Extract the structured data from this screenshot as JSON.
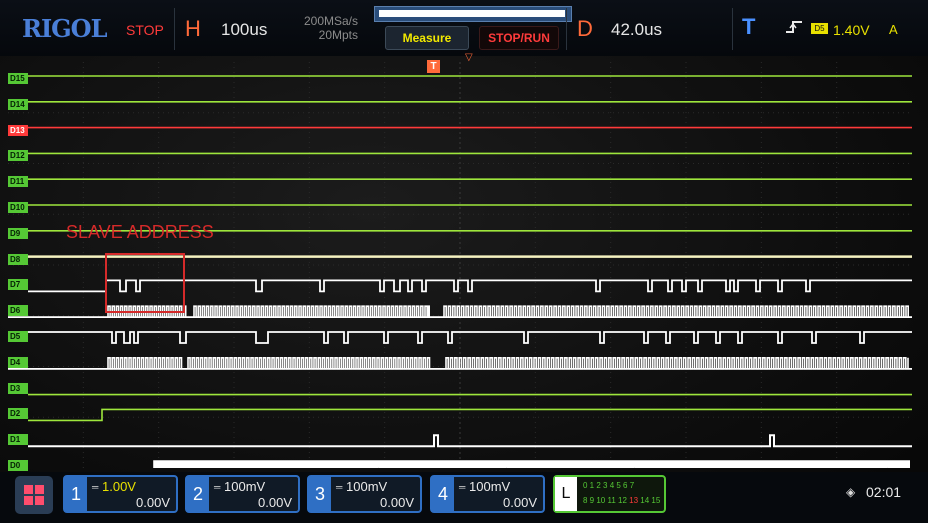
{
  "topbar": {
    "logo": "RIGOL",
    "status": "STOP",
    "h_label": "H",
    "h_value": "100us",
    "sample_rate": "200MSa/s",
    "mem_depth": "20Mpts",
    "measure_label": "Measure",
    "stoprun_label": "STOP/RUN",
    "d_label": "D",
    "d_value": "42.0us",
    "t_label": "T",
    "trigger_icon": "rising-edge-icon",
    "trigger_source": "D5",
    "trigger_level": "1.40V",
    "trigger_mode": "A"
  },
  "plot": {
    "trigger_marker": "T",
    "channels": [
      "D15",
      "D14",
      "D13",
      "D12",
      "D11",
      "D10",
      "D9",
      "D8",
      "D7",
      "D6",
      "D5",
      "D4",
      "D3",
      "D2",
      "D1",
      "D0"
    ],
    "highlight_channel": "D13",
    "annotation": "SLAVE ADDRESS"
  },
  "bottombar": {
    "ch1": {
      "num": "1",
      "scale": "1.00V",
      "offset": "0.00V"
    },
    "ch2": {
      "num": "2",
      "scale": "100mV",
      "offset": "0.00V"
    },
    "ch3": {
      "num": "3",
      "scale": "100mV",
      "offset": "0.00V"
    },
    "ch4": {
      "num": "4",
      "scale": "100mV",
      "offset": "0.00V"
    },
    "la": {
      "num": "L",
      "row1": "0 1 2 3  4 5 6 7",
      "row2a": "8 9 10 11 12",
      "row2b": "13",
      "row2c": "14 15"
    },
    "time": "02:01"
  },
  "colors": {
    "trace_green": "#9ee63c",
    "trace_white": "#ffffff",
    "trace_red": "#ff3a3a",
    "trace_yellow": "#f5f2c0",
    "accent_blue": "#2f6fc4",
    "accent_orange": "#ff6a3a",
    "trigger_yellow": "#e8e000"
  }
}
